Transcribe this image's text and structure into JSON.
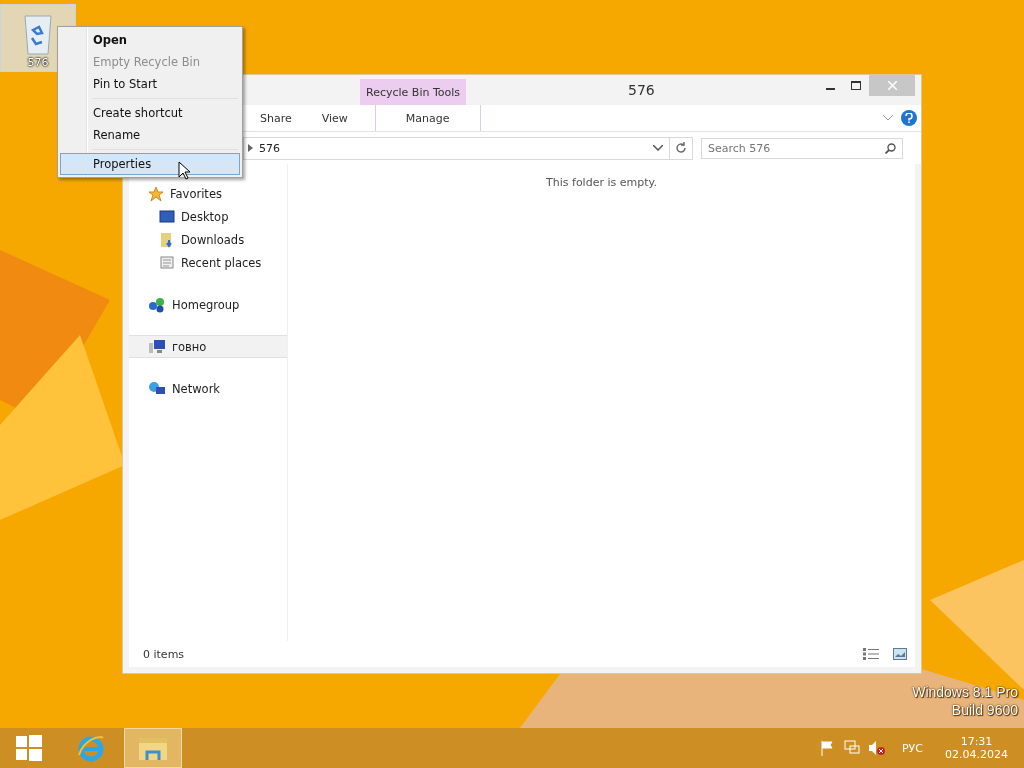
{
  "desktop": {
    "icons": [
      {
        "label": "576",
        "selected": true
      }
    ],
    "watermark": [
      "Windows 8.1 Pro",
      "Build 9600"
    ]
  },
  "context_menu": {
    "groups": [
      [
        {
          "label": "Open",
          "bold": true,
          "disabled": false,
          "selected": false
        },
        {
          "label": "Empty Recycle Bin",
          "bold": false,
          "disabled": true,
          "selected": false
        },
        {
          "label": "Pin to Start",
          "bold": false,
          "disabled": false,
          "selected": false
        }
      ],
      [
        {
          "label": "Create shortcut",
          "bold": false,
          "disabled": false,
          "selected": false
        },
        {
          "label": "Rename",
          "bold": false,
          "disabled": false,
          "selected": false
        }
      ],
      [
        {
          "label": "Properties",
          "bold": false,
          "disabled": false,
          "selected": true
        }
      ]
    ]
  },
  "window": {
    "title": "576",
    "contextual_group": "Recycle Bin Tools",
    "tabs": [
      {
        "label": "Share",
        "selected": false,
        "contextual": false
      },
      {
        "label": "View",
        "selected": false,
        "contextual": false
      },
      {
        "label": "Manage",
        "selected": false,
        "contextual": true
      }
    ],
    "address": "576",
    "search": {
      "placeholder": "Search 576"
    },
    "nav": [
      {
        "label": "Favorites",
        "kind": "star",
        "selected": false,
        "children": [
          {
            "label": "Desktop",
            "kind": "desktop",
            "selected": false
          },
          {
            "label": "Downloads",
            "kind": "downloads",
            "selected": false
          },
          {
            "label": "Recent places",
            "kind": "recent",
            "selected": false
          }
        ]
      },
      {
        "label": "Homegroup",
        "kind": "homegroup",
        "selected": false
      },
      {
        "label": "говно",
        "kind": "computer",
        "selected": true
      },
      {
        "label": "Network",
        "kind": "network",
        "selected": false
      }
    ],
    "empty_message": "This folder is empty.",
    "status": "0 items"
  },
  "taskbar": {
    "apps": [
      {
        "kind": "ie",
        "selected": false
      },
      {
        "kind": "explorer",
        "selected": true
      }
    ],
    "language": "РУС",
    "time": "17:31",
    "date": "02.04.2024"
  }
}
